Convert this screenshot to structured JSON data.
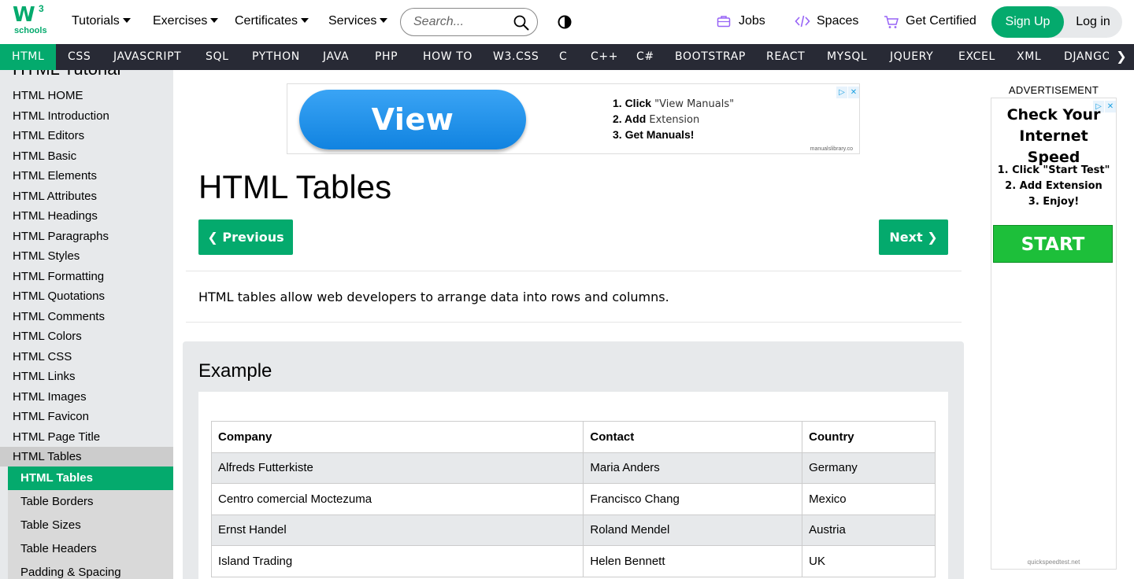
{
  "logo": {
    "main": "W",
    "superscript": "3",
    "sub": "schools"
  },
  "topnav": {
    "tutorials": "Tutorials",
    "exercises": "Exercises",
    "certificates": "Certificates",
    "services": "Services"
  },
  "search": {
    "placeholder": "Search..."
  },
  "header_links": {
    "jobs": "Jobs",
    "spaces": "Spaces",
    "get_certified": "Get Certified"
  },
  "auth": {
    "signup": "Sign Up",
    "login": "Log in"
  },
  "subnav": {
    "items": [
      "HTML",
      "CSS",
      "JAVASCRIPT",
      "SQL",
      "PYTHON",
      "JAVA",
      "PHP",
      "HOW TO",
      "W3.CSS",
      "C",
      "C++",
      "C#",
      "BOOTSTRAP",
      "REACT",
      "MYSQL",
      "JQUERY",
      "EXCEL",
      "XML",
      "DJANGO"
    ],
    "active": "HTML",
    "more_glyph": "❯"
  },
  "sidebar": {
    "title": "HTML Tutorial",
    "items": [
      "HTML HOME",
      "HTML Introduction",
      "HTML Editors",
      "HTML Basic",
      "HTML Elements",
      "HTML Attributes",
      "HTML Headings",
      "HTML Paragraphs",
      "HTML Styles",
      "HTML Formatting",
      "HTML Quotations",
      "HTML Comments",
      "HTML Colors",
      "HTML CSS",
      "HTML Links",
      "HTML Images",
      "HTML Favicon",
      "HTML Page Title",
      "HTML Tables"
    ],
    "sub_items": [
      "HTML Tables",
      "Table Borders",
      "Table Sizes",
      "Table Headers",
      "Padding & Spacing"
    ]
  },
  "ad_top": {
    "button": "View Manuals",
    "step1_bold": "1. Click",
    "step1_rest": " \"View Manuals\"",
    "step2_bold": "2. Add",
    "step2_rest": " Extension",
    "step3": "3. Get Manuals!",
    "source": "manualslibrary.co"
  },
  "main": {
    "title": "HTML Tables",
    "prev": "❮ Previous",
    "next": "Next ❯",
    "intro": "HTML tables allow web developers to arrange data into rows and columns."
  },
  "example": {
    "title": "Example",
    "headers": [
      "Company",
      "Contact",
      "Country"
    ],
    "rows": [
      [
        "Alfreds Futterkiste",
        "Maria Anders",
        "Germany"
      ],
      [
        "Centro comercial Moctezuma",
        "Francisco Chang",
        "Mexico"
      ],
      [
        "Ernst Handel",
        "Roland Mendel",
        "Austria"
      ],
      [
        "Island Trading",
        "Helen Bennett",
        "UK"
      ]
    ]
  },
  "ad_right": {
    "label": "ADVERTISEMENT",
    "headline_1": "Check Your",
    "headline_2": "Internet Speed",
    "step1": "1. Click \"Start Test\"",
    "step2": "2. Add Extension",
    "step3": "3. Enjoy!",
    "button": "START TEST",
    "source": "quickspeedtest.net"
  },
  "colors": {
    "brand_green": "#04aa6d",
    "dark_nav": "#282a35",
    "sidebar_bg": "#e7e9eb"
  }
}
